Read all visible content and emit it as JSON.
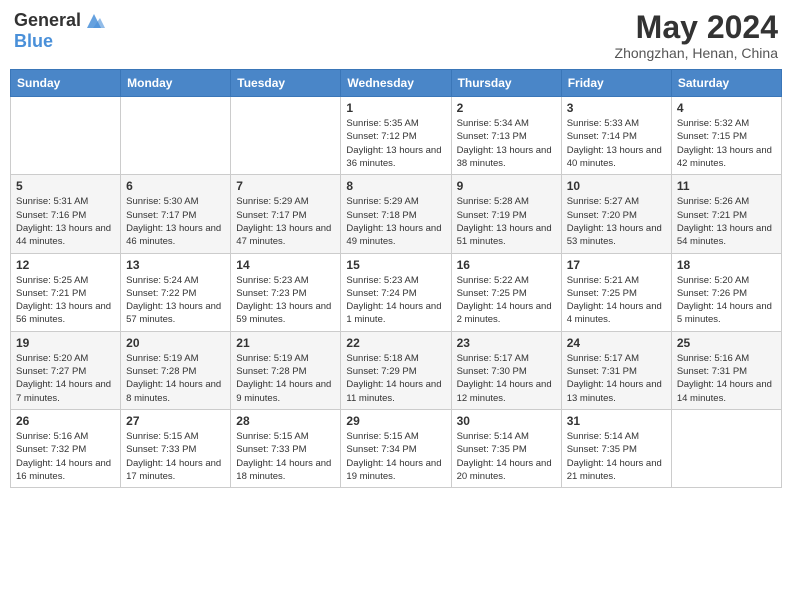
{
  "logo": {
    "general": "General",
    "blue": "Blue"
  },
  "title": {
    "month_year": "May 2024",
    "location": "Zhongzhan, Henan, China"
  },
  "weekdays": [
    "Sunday",
    "Monday",
    "Tuesday",
    "Wednesday",
    "Thursday",
    "Friday",
    "Saturday"
  ],
  "weeks": [
    [
      {
        "day": "",
        "info": ""
      },
      {
        "day": "",
        "info": ""
      },
      {
        "day": "",
        "info": ""
      },
      {
        "day": "1",
        "info": "Sunrise: 5:35 AM\nSunset: 7:12 PM\nDaylight: 13 hours and 36 minutes."
      },
      {
        "day": "2",
        "info": "Sunrise: 5:34 AM\nSunset: 7:13 PM\nDaylight: 13 hours and 38 minutes."
      },
      {
        "day": "3",
        "info": "Sunrise: 5:33 AM\nSunset: 7:14 PM\nDaylight: 13 hours and 40 minutes."
      },
      {
        "day": "4",
        "info": "Sunrise: 5:32 AM\nSunset: 7:15 PM\nDaylight: 13 hours and 42 minutes."
      }
    ],
    [
      {
        "day": "5",
        "info": "Sunrise: 5:31 AM\nSunset: 7:16 PM\nDaylight: 13 hours and 44 minutes."
      },
      {
        "day": "6",
        "info": "Sunrise: 5:30 AM\nSunset: 7:17 PM\nDaylight: 13 hours and 46 minutes."
      },
      {
        "day": "7",
        "info": "Sunrise: 5:29 AM\nSunset: 7:17 PM\nDaylight: 13 hours and 47 minutes."
      },
      {
        "day": "8",
        "info": "Sunrise: 5:29 AM\nSunset: 7:18 PM\nDaylight: 13 hours and 49 minutes."
      },
      {
        "day": "9",
        "info": "Sunrise: 5:28 AM\nSunset: 7:19 PM\nDaylight: 13 hours and 51 minutes."
      },
      {
        "day": "10",
        "info": "Sunrise: 5:27 AM\nSunset: 7:20 PM\nDaylight: 13 hours and 53 minutes."
      },
      {
        "day": "11",
        "info": "Sunrise: 5:26 AM\nSunset: 7:21 PM\nDaylight: 13 hours and 54 minutes."
      }
    ],
    [
      {
        "day": "12",
        "info": "Sunrise: 5:25 AM\nSunset: 7:21 PM\nDaylight: 13 hours and 56 minutes."
      },
      {
        "day": "13",
        "info": "Sunrise: 5:24 AM\nSunset: 7:22 PM\nDaylight: 13 hours and 57 minutes."
      },
      {
        "day": "14",
        "info": "Sunrise: 5:23 AM\nSunset: 7:23 PM\nDaylight: 13 hours and 59 minutes."
      },
      {
        "day": "15",
        "info": "Sunrise: 5:23 AM\nSunset: 7:24 PM\nDaylight: 14 hours and 1 minute."
      },
      {
        "day": "16",
        "info": "Sunrise: 5:22 AM\nSunset: 7:25 PM\nDaylight: 14 hours and 2 minutes."
      },
      {
        "day": "17",
        "info": "Sunrise: 5:21 AM\nSunset: 7:25 PM\nDaylight: 14 hours and 4 minutes."
      },
      {
        "day": "18",
        "info": "Sunrise: 5:20 AM\nSunset: 7:26 PM\nDaylight: 14 hours and 5 minutes."
      }
    ],
    [
      {
        "day": "19",
        "info": "Sunrise: 5:20 AM\nSunset: 7:27 PM\nDaylight: 14 hours and 7 minutes."
      },
      {
        "day": "20",
        "info": "Sunrise: 5:19 AM\nSunset: 7:28 PM\nDaylight: 14 hours and 8 minutes."
      },
      {
        "day": "21",
        "info": "Sunrise: 5:19 AM\nSunset: 7:28 PM\nDaylight: 14 hours and 9 minutes."
      },
      {
        "day": "22",
        "info": "Sunrise: 5:18 AM\nSunset: 7:29 PM\nDaylight: 14 hours and 11 minutes."
      },
      {
        "day": "23",
        "info": "Sunrise: 5:17 AM\nSunset: 7:30 PM\nDaylight: 14 hours and 12 minutes."
      },
      {
        "day": "24",
        "info": "Sunrise: 5:17 AM\nSunset: 7:31 PM\nDaylight: 14 hours and 13 minutes."
      },
      {
        "day": "25",
        "info": "Sunrise: 5:16 AM\nSunset: 7:31 PM\nDaylight: 14 hours and 14 minutes."
      }
    ],
    [
      {
        "day": "26",
        "info": "Sunrise: 5:16 AM\nSunset: 7:32 PM\nDaylight: 14 hours and 16 minutes."
      },
      {
        "day": "27",
        "info": "Sunrise: 5:15 AM\nSunset: 7:33 PM\nDaylight: 14 hours and 17 minutes."
      },
      {
        "day": "28",
        "info": "Sunrise: 5:15 AM\nSunset: 7:33 PM\nDaylight: 14 hours and 18 minutes."
      },
      {
        "day": "29",
        "info": "Sunrise: 5:15 AM\nSunset: 7:34 PM\nDaylight: 14 hours and 19 minutes."
      },
      {
        "day": "30",
        "info": "Sunrise: 5:14 AM\nSunset: 7:35 PM\nDaylight: 14 hours and 20 minutes."
      },
      {
        "day": "31",
        "info": "Sunrise: 5:14 AM\nSunset: 7:35 PM\nDaylight: 14 hours and 21 minutes."
      },
      {
        "day": "",
        "info": ""
      }
    ]
  ]
}
